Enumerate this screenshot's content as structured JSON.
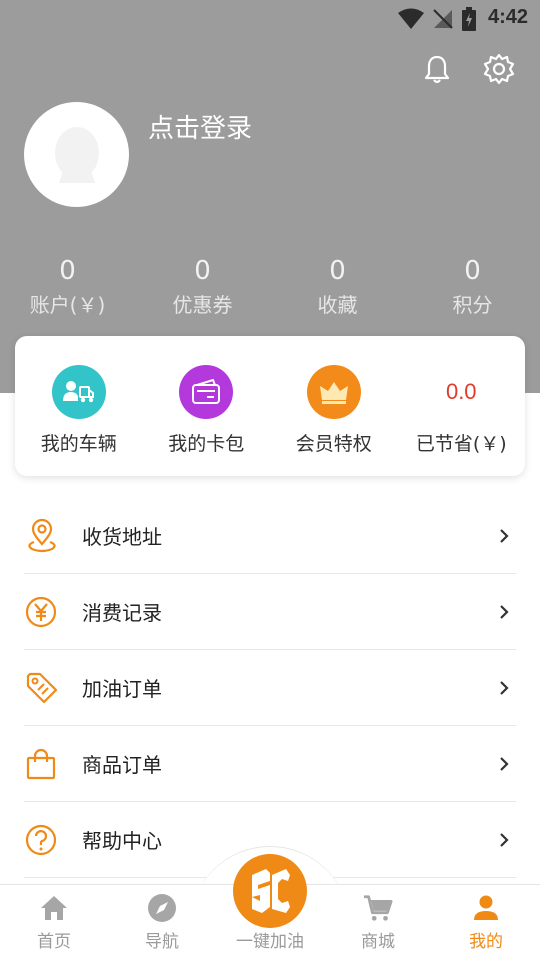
{
  "status": {
    "time": "4:42"
  },
  "profile": {
    "login_text": "点击登录"
  },
  "stats": [
    {
      "value": "0",
      "label": "账户(￥)"
    },
    {
      "value": "0",
      "label": "优惠券"
    },
    {
      "value": "0",
      "label": "收藏"
    },
    {
      "value": "0",
      "label": "积分"
    }
  ],
  "card": {
    "items": [
      {
        "label": "我的车辆",
        "icon": "car-icon",
        "color": "#33c4c9"
      },
      {
        "label": "我的卡包",
        "icon": "wallet-icon",
        "color": "#b439dd"
      },
      {
        "label": "会员特权",
        "icon": "crown-icon",
        "color": "#f28b1a"
      },
      {
        "label": "已节省(￥)",
        "value": "0.0"
      }
    ]
  },
  "menu": [
    {
      "label": "收货地址",
      "icon": "location-icon"
    },
    {
      "label": "消费记录",
      "icon": "yuan-icon"
    },
    {
      "label": "加油订单",
      "icon": "tag-icon"
    },
    {
      "label": "商品订单",
      "icon": "bag-icon"
    },
    {
      "label": "帮助中心",
      "icon": "help-icon"
    }
  ],
  "tabs": [
    {
      "label": "首页",
      "icon": "home-icon"
    },
    {
      "label": "导航",
      "icon": "compass-icon"
    },
    {
      "label": "一键加油",
      "icon": "fuel-logo-icon"
    },
    {
      "label": "商城",
      "icon": "cart-icon"
    },
    {
      "label": "我的",
      "icon": "user-icon"
    }
  ],
  "colors": {
    "accent": "#f08a17",
    "header": "#9c9c9c",
    "saved": "#e23a2c"
  }
}
